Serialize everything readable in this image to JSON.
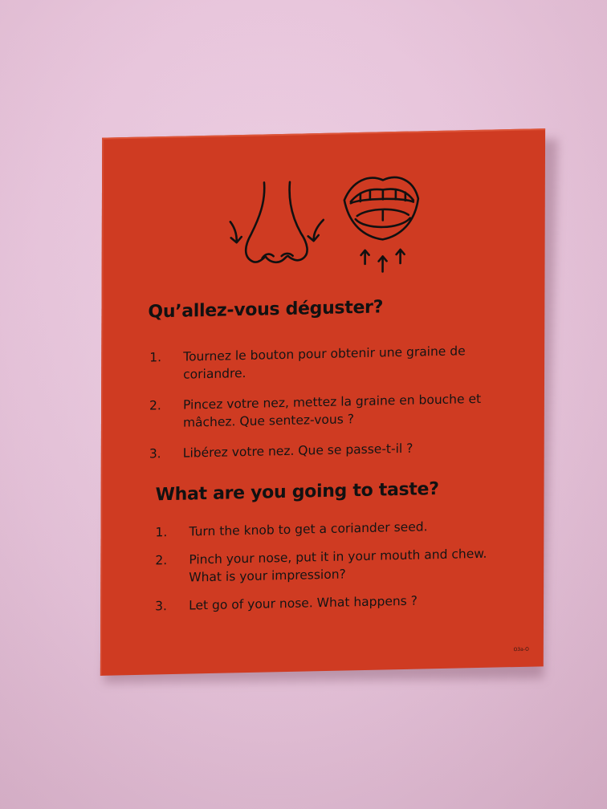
{
  "sign": {
    "background_color": "#cf3b22",
    "wall_color": "#e7c2da",
    "icons": [
      "nose-icon",
      "open-mouth-icon"
    ],
    "french": {
      "title": "Qu’allez-vous déguster?",
      "items": [
        {
          "num": "1.",
          "text": "Tournez le bouton pour obtenir une graine de coriandre."
        },
        {
          "num": "2.",
          "text": "Pincez votre nez, mettez la graine en bouche et mâchez. Que sentez-vous ?"
        },
        {
          "num": "3.",
          "text": "Libérez votre nez. Que se passe-t-il ?"
        }
      ]
    },
    "english": {
      "title": "What are you going to taste?",
      "items": [
        {
          "num": "1.",
          "text": "Turn the knob to get a coriander seed."
        },
        {
          "num": "2.",
          "text": "Pinch your nose, put it in your mouth and chew. What is your impression?"
        },
        {
          "num": "3.",
          "text": "Let go of your nose. What happens ?"
        }
      ]
    },
    "code": "O3a-O"
  }
}
